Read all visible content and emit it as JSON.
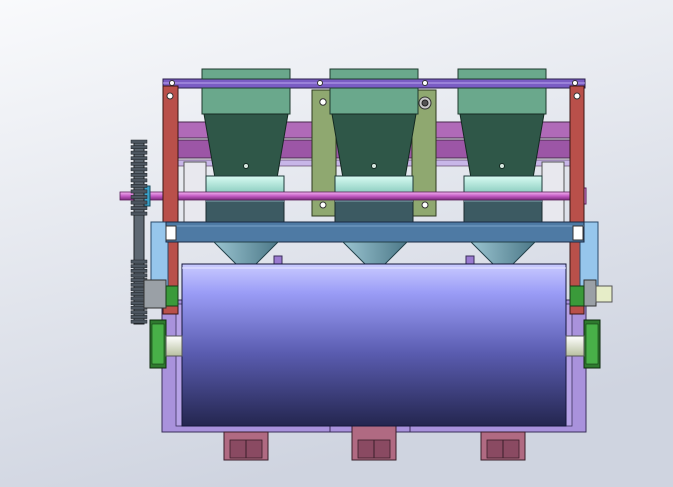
{
  "view": {
    "background_top": "#f9fafc",
    "background_bottom": "#cfd4e0"
  },
  "colors": {
    "frame_red": "#b9504a",
    "frame_dark": "#5a2a28",
    "top_bar": "#7a5cc4",
    "hopper_top": "#6aa88c",
    "hopper_body": "#2f5748",
    "cross_bar": "#b06ab8",
    "middle_plate": "#8fa870",
    "seed_box_top": "#c8efe4",
    "seed_box_body": "#3c5a62",
    "shaft": "#d27ad0",
    "sprocket": "#4d5660",
    "side_plate": "#96c6ec",
    "beam": "#4e7aa4",
    "funnel": "#5c8898",
    "roller_light": "#b9baff",
    "roller_dark": "#2c2e66",
    "frame_lower": "#a992dc",
    "wheel_green": "#3a9a3a",
    "foot_pink": "#b06a82",
    "axle_cap": "#e6edc8"
  },
  "parts": {
    "hopper_count": 3,
    "sprocket_teeth": 28
  }
}
